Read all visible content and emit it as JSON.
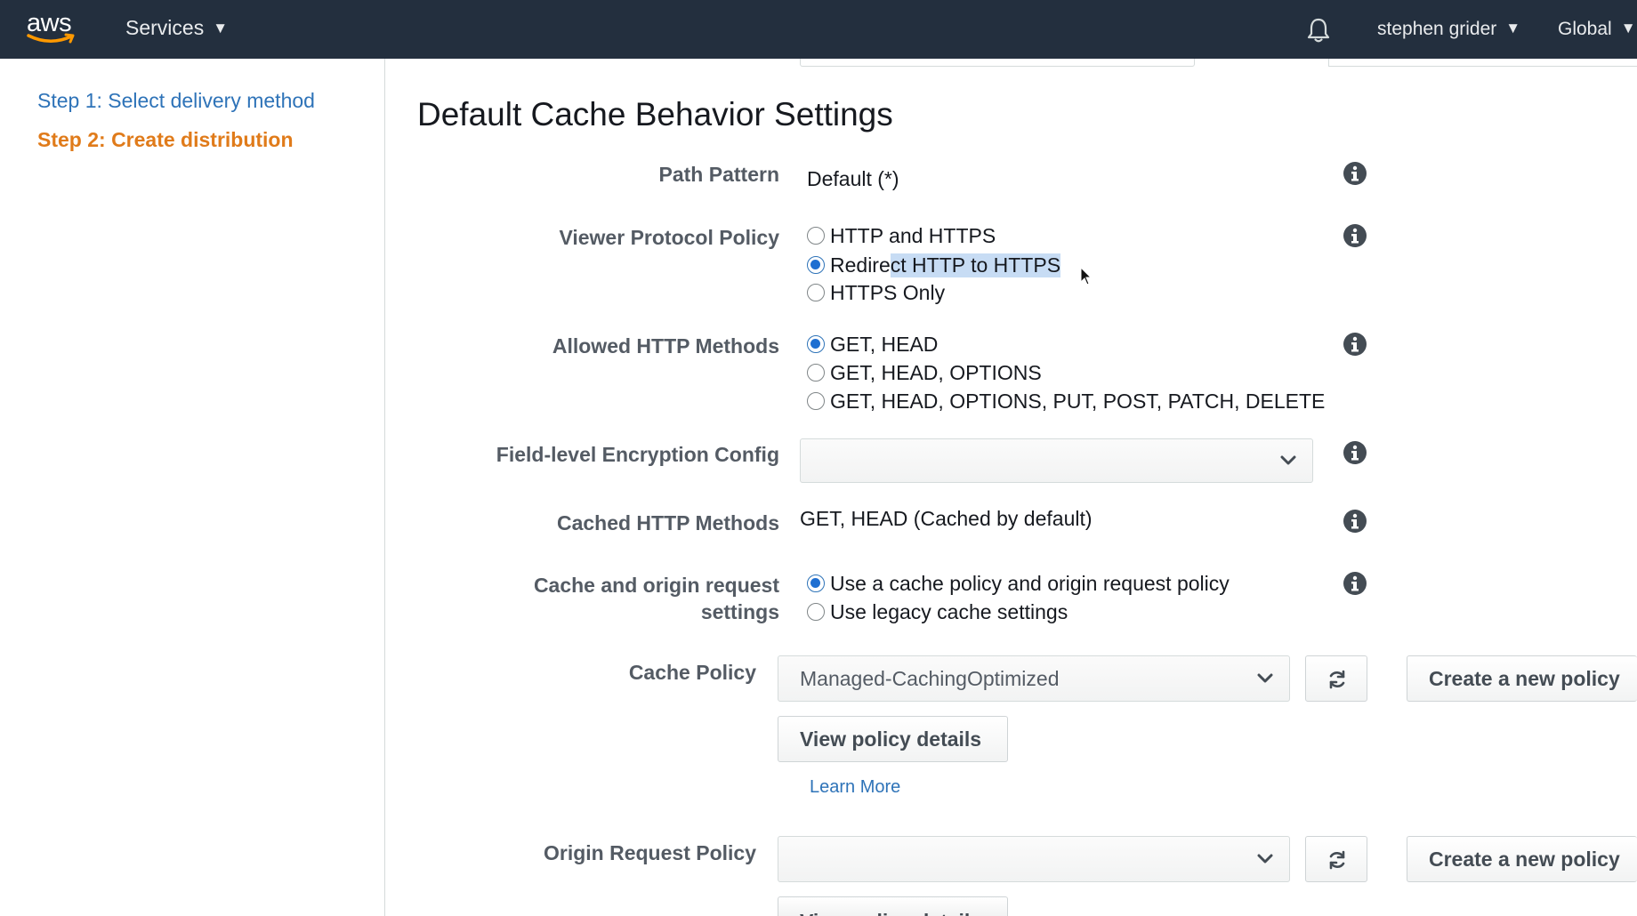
{
  "nav": {
    "logo_text": "aws",
    "services_label": "Services",
    "user_label": "stephen grider",
    "region_label": "Global",
    "brand_color": "#232f3e",
    "icons": [
      "notification-bell-icon",
      "caret-down-icon"
    ]
  },
  "sidebar": {
    "steps": [
      {
        "label": "Step 1: Select delivery method",
        "state": "link"
      },
      {
        "label": "Step 2: Create distribution",
        "state": "current"
      }
    ]
  },
  "main": {
    "section_title": "Default Cache Behavior Settings",
    "path_pattern": {
      "label": "Path Pattern",
      "value": "Default (*)"
    },
    "viewer_protocol_policy": {
      "label": "Viewer Protocol Policy",
      "options": [
        {
          "label_a": "HTTP and HTTPS",
          "label_b": "",
          "selected": false
        },
        {
          "label_a": "Redire",
          "label_b": "ct HTTP to HTTPS",
          "selected": true
        },
        {
          "label_a": "HTTPS Only",
          "label_b": "",
          "selected": false
        }
      ]
    },
    "allowed_http_methods": {
      "label": "Allowed HTTP Methods",
      "options": [
        {
          "label": "GET, HEAD",
          "selected": true
        },
        {
          "label": "GET, HEAD, OPTIONS",
          "selected": false
        },
        {
          "label": "GET, HEAD, OPTIONS, PUT, POST, PATCH, DELETE",
          "selected": false
        }
      ]
    },
    "field_level_encryption": {
      "label": "Field-level Encryption Config",
      "value": ""
    },
    "cached_http_methods": {
      "label": "Cached HTTP Methods",
      "value": "GET, HEAD (Cached by default)"
    },
    "cache_origin_settings": {
      "label_line1": "Cache and origin request",
      "label_line2": "settings",
      "options": [
        {
          "label": "Use a cache policy and origin request policy",
          "selected": true
        },
        {
          "label": "Use legacy cache settings",
          "selected": false
        }
      ]
    },
    "cache_policy": {
      "label": "Cache Policy",
      "value": "Managed-CachingOptimized",
      "create_label": "Create a new policy",
      "view_details_label": "View policy details",
      "learn_more_label": "Learn More"
    },
    "origin_request_policy": {
      "label": "Origin Request Policy",
      "value": "",
      "create_label": "Create a new policy",
      "view_details_label": "View policy details"
    }
  },
  "colors": {
    "link": "#2e73b8",
    "current_step": "#e07b1a",
    "radio_selected": "#1f6fd1",
    "text_highlight": "#c7dcf4"
  }
}
